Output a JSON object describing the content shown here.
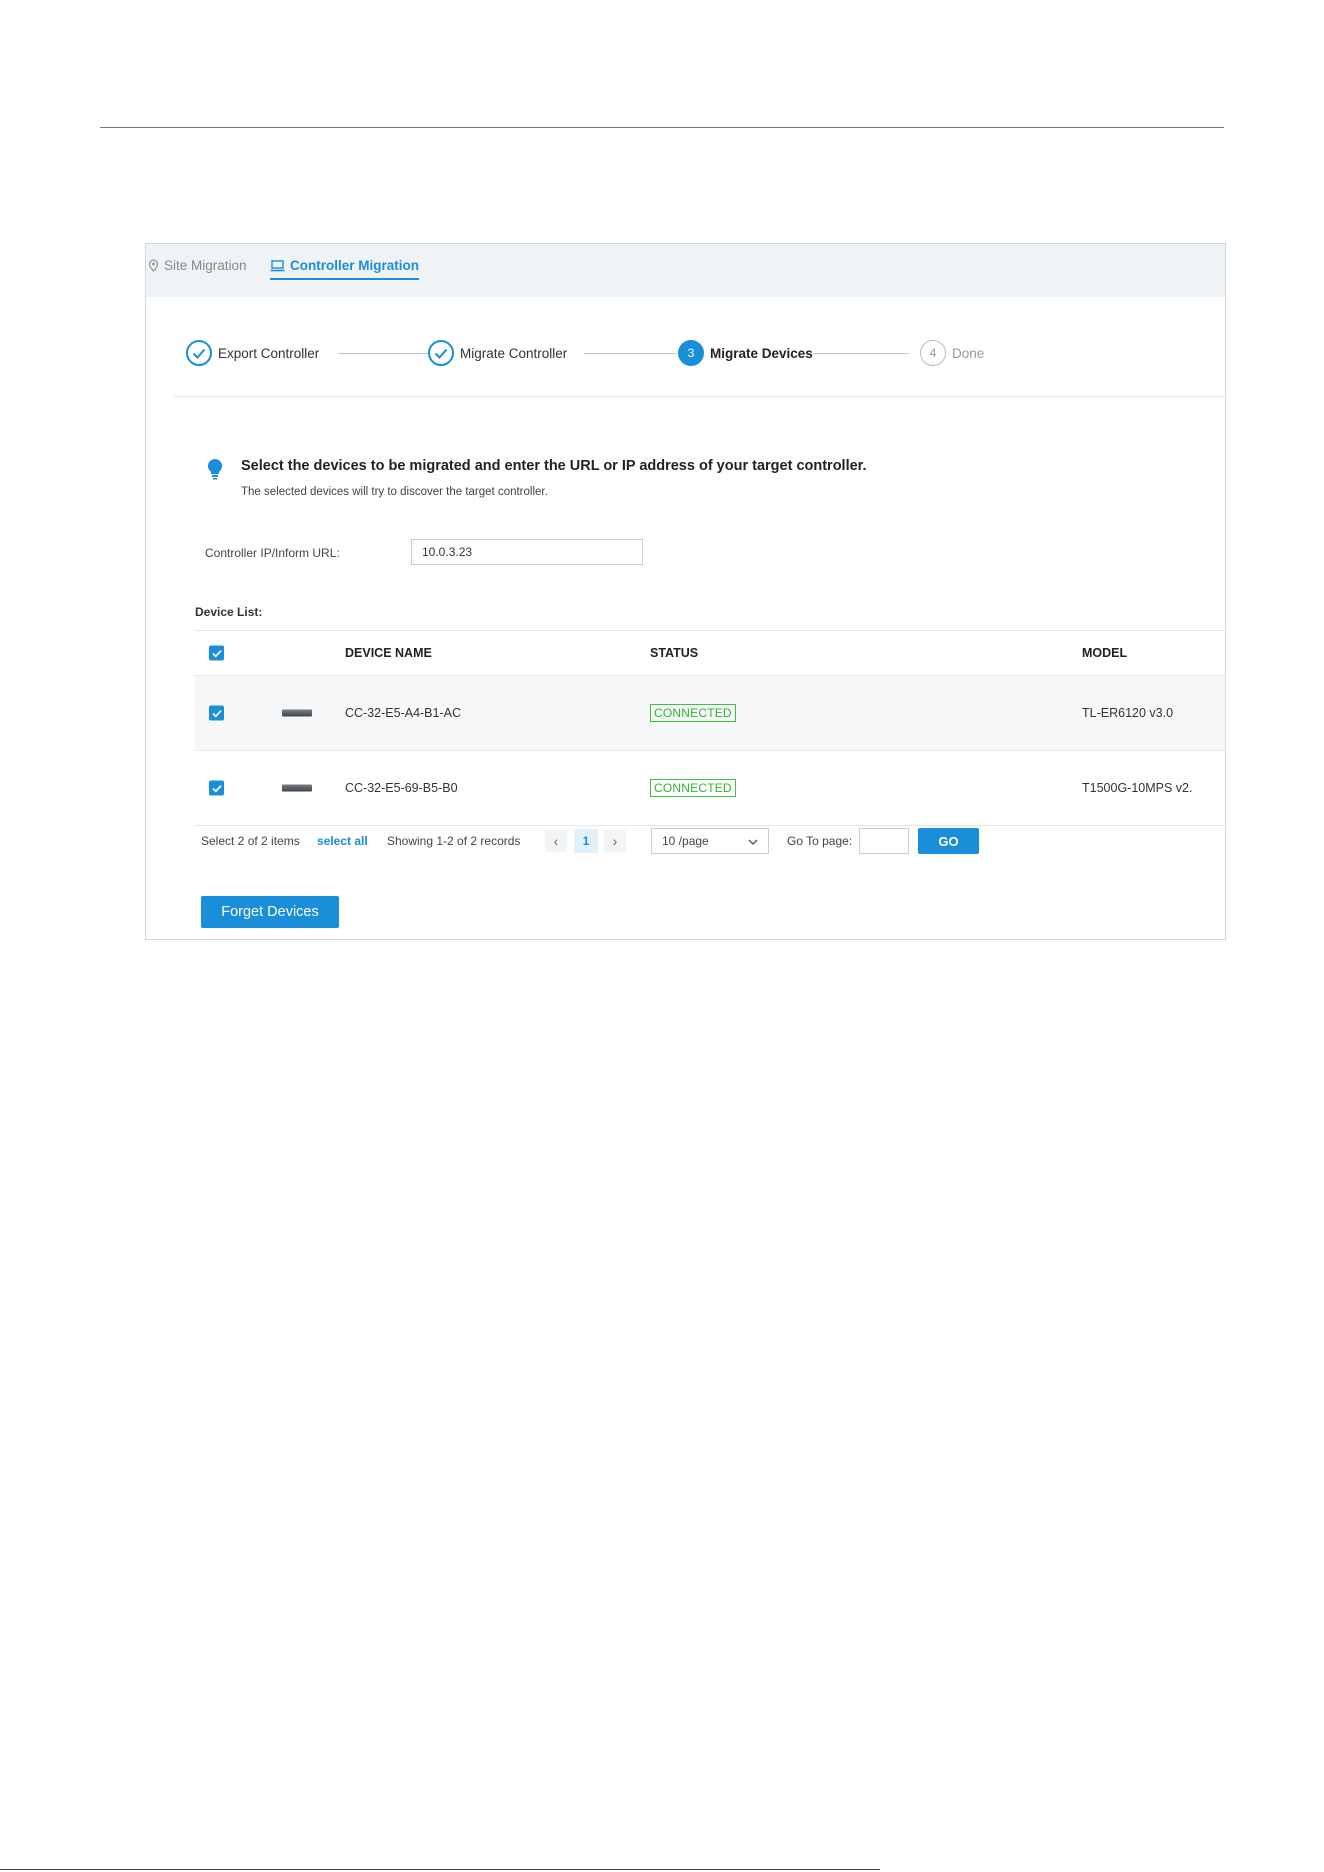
{
  "tabs": {
    "site_migration": "Site Migration",
    "controller_migration": "Controller Migration"
  },
  "stepper": {
    "steps": [
      {
        "label": "Export Controller",
        "state": "done"
      },
      {
        "label": "Migrate Controller",
        "state": "done"
      },
      {
        "label": "Migrate Devices",
        "state": "active",
        "number": "3"
      },
      {
        "label": "Done",
        "state": "todo",
        "number": "4"
      }
    ]
  },
  "tip": {
    "title": "Select the devices to be migrated and enter the URL or IP address of your target controller.",
    "subtitle": "The selected devices will try to discover the target controller."
  },
  "form": {
    "ip_label": "Controller IP/Inform URL:",
    "ip_value": "10.0.3.23"
  },
  "device_list": {
    "label": "Device List:",
    "columns": {
      "name": "DEVICE NAME",
      "status": "STATUS",
      "model": "MODEL"
    },
    "rows": [
      {
        "name": "CC-32-E5-A4-B1-AC",
        "status": "CONNECTED",
        "model": "TL-ER6120 v3.0",
        "checked": true
      },
      {
        "name": "CC-32-E5-69-B5-B0",
        "status": "CONNECTED",
        "model": "T1500G-10MPS v2.",
        "checked": true
      }
    ]
  },
  "pagination": {
    "selected_text": "Select 2 of 2 items",
    "select_all": "select all",
    "showing": "Showing 1-2 of 2 records",
    "current_page": "1",
    "per_page": "10 /page",
    "go_to_label": "Go To page:",
    "go_button": "GO"
  },
  "actions": {
    "forget_devices": "Forget Devices"
  },
  "colors": {
    "accent": "#1a8ed8",
    "connected": "#2fb52f",
    "tab_bar_bg": "#f0f3f6"
  }
}
